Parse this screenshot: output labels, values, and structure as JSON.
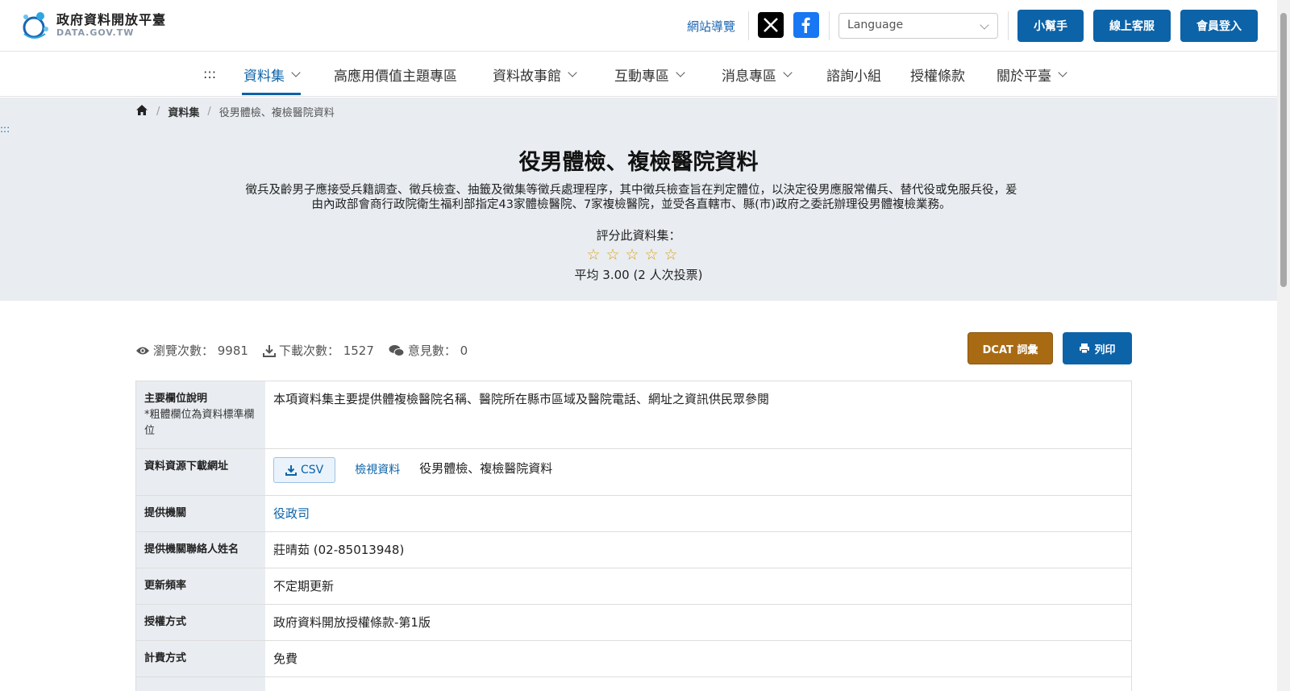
{
  "header": {
    "logo_title": "政府資料開放平臺",
    "logo_sub": "DATA.GOV.TW",
    "site_nav": "網站導覽",
    "language_placeholder": "Language",
    "buttons": {
      "helper": "小幫手",
      "service": "線上客服",
      "login": "會員登入"
    }
  },
  "nav": {
    "dots": ":::",
    "items": [
      "資料集",
      "高應用價值主題專區",
      "資料故事館",
      "互動專區",
      "消息專區",
      "諮詢小組",
      "授權條款",
      "關於平臺"
    ]
  },
  "breadcrumb": {
    "level1": "資料集",
    "current": "役男體檢、複檢醫院資料"
  },
  "side_dots": ":::",
  "dataset": {
    "title": "役男體檢、複檢醫院資料",
    "description": "徵兵及齡男子應接受兵籍調查、徵兵檢查、抽籤及徵集等徵兵處理程序，其中徵兵檢查旨在判定體位，以決定役男應服常備兵、替代役或免服兵役，爰由內政部會商行政院衛生福利部指定43家體檢醫院、7家複檢醫院，並受各直轄市、縣(市)政府之委託辦理役男體複檢業務。",
    "rating_label": "評分此資料集：",
    "rating_avg": "平均 3.00 (2 人次投票)",
    "stars_filled": 0,
    "stars_total": 5
  },
  "stats": {
    "views": "瀏覽次數： 9981",
    "downloads": "下載次數： 1527",
    "comments": "意見數： 0"
  },
  "actions": {
    "dcat": "DCAT 詞彙",
    "print": "列印"
  },
  "table": {
    "main_fields_label": "主要欄位說明",
    "main_fields_note": "*粗體欄位為資料標準欄位",
    "main_fields_value": "本項資料集主要提供體複檢醫院名稱、醫院所在縣市區域及醫院電話、網址之資訊供民眾參閱",
    "resource_label": "資料資源下載網址",
    "resource_csv": "CSV",
    "resource_view": "檢視資料",
    "resource_name": "役男體檢、複檢醫院資料",
    "provider_label": "提供機關",
    "provider_value": "役政司",
    "contact_label": "提供機關聯絡人姓名",
    "contact_value": "莊晴茹 (02-85013948)",
    "frequency_label": "更新頻率",
    "frequency_value": "不定期更新",
    "license_label": "授權方式",
    "license_value": "政府資料開放授權條款-第1版",
    "fee_label": "計費方式",
    "fee_value": "免費"
  },
  "colors": {
    "primary": "#0c63a8",
    "dcat": "#a86b14",
    "hero_bg": "#e9edf1",
    "star": "#d9a21b"
  }
}
